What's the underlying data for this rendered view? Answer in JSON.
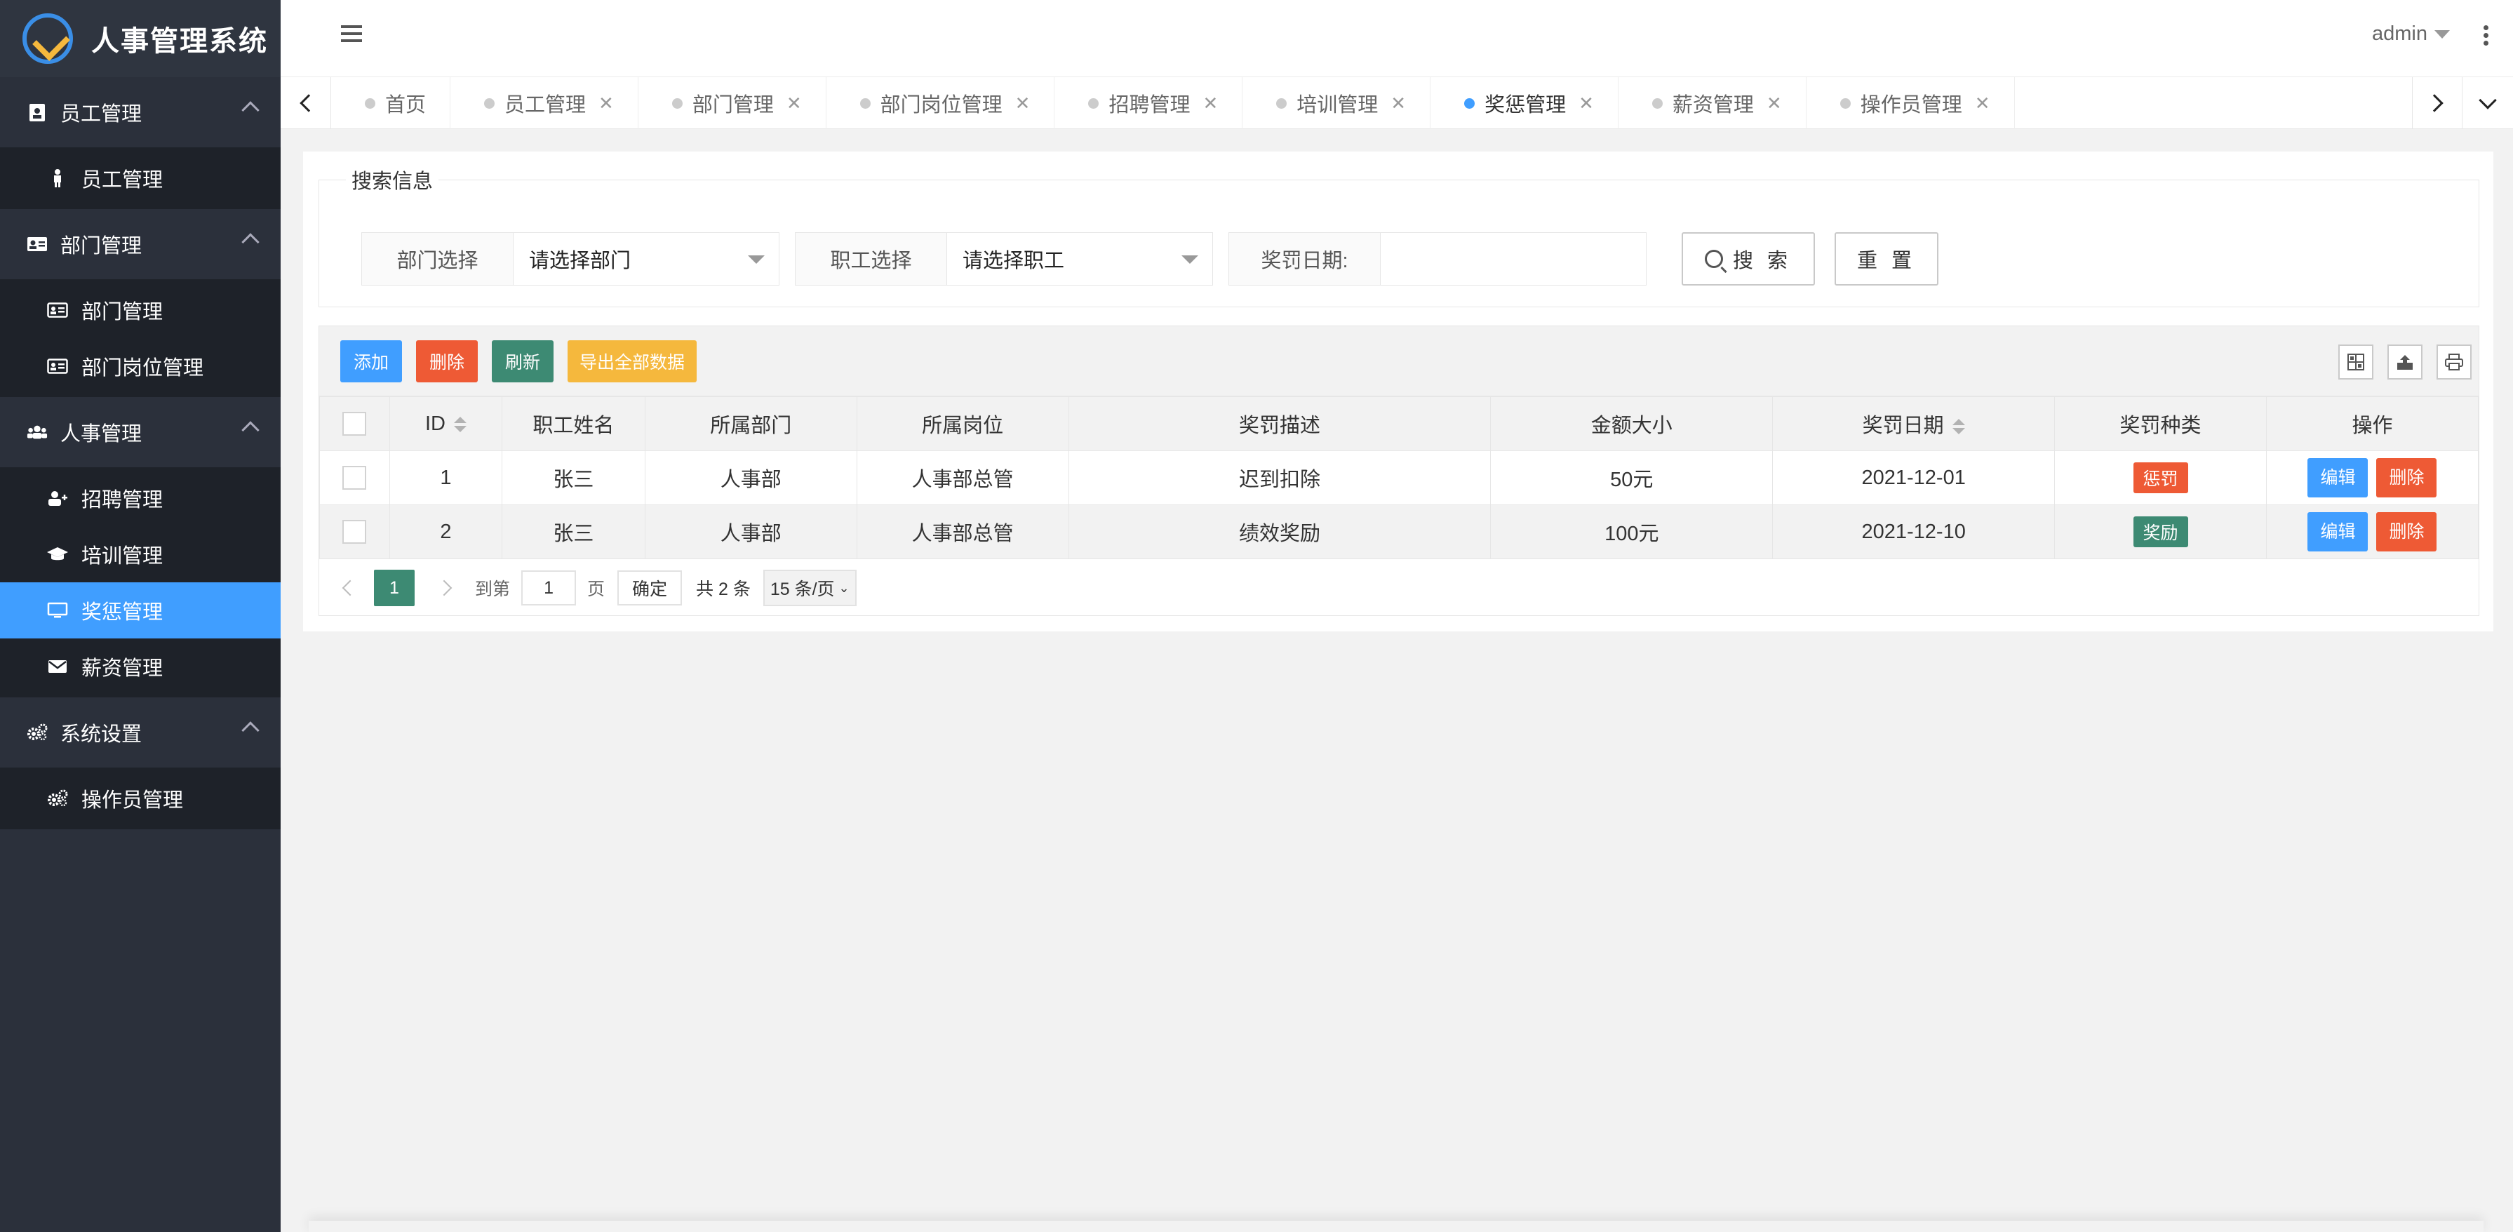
{
  "app": {
    "title": "人事管理系统"
  },
  "header": {
    "user": "admin"
  },
  "sidebar": {
    "groups": [
      {
        "label": "员工管理",
        "items": [
          {
            "label": "员工管理"
          }
        ]
      },
      {
        "label": "部门管理",
        "items": [
          {
            "label": "部门管理"
          },
          {
            "label": "部门岗位管理"
          }
        ]
      },
      {
        "label": "人事管理",
        "items": [
          {
            "label": "招聘管理"
          },
          {
            "label": "培训管理"
          },
          {
            "label": "奖惩管理",
            "active": true
          },
          {
            "label": "薪资管理"
          }
        ]
      },
      {
        "label": "系统设置",
        "items": [
          {
            "label": "操作员管理"
          }
        ]
      }
    ]
  },
  "tabs": [
    {
      "label": "首页"
    },
    {
      "label": "员工管理"
    },
    {
      "label": "部门管理"
    },
    {
      "label": "部门岗位管理"
    },
    {
      "label": "招聘管理"
    },
    {
      "label": "培训管理"
    },
    {
      "label": "奖惩管理",
      "active": true
    },
    {
      "label": "薪资管理"
    },
    {
      "label": "操作员管理"
    }
  ],
  "search": {
    "legend": "搜索信息",
    "dept_label": "部门选择",
    "dept_value": "请选择部门",
    "staff_label": "职工选择",
    "staff_value": "请选择职工",
    "date_label": "奖罚日期:",
    "date_value": "",
    "search_btn": "搜 索",
    "reset_btn": "重 置"
  },
  "toolbar": {
    "add": "添加",
    "delete": "删除",
    "refresh": "刷新",
    "export": "导出全部数据"
  },
  "table": {
    "columns": [
      "ID",
      "职工姓名",
      "所属部门",
      "所属岗位",
      "奖罚描述",
      "金额大小",
      "奖罚日期",
      "奖罚种类",
      "操作"
    ],
    "rows": [
      {
        "id": "1",
        "name": "张三",
        "dept": "人事部",
        "post": "人事部总管",
        "desc": "迟到扣除",
        "amount": "50元",
        "date": "2021-12-01",
        "type": "惩罚",
        "type_color": "#ee5a35",
        "edit": "编辑",
        "del": "删除"
      },
      {
        "id": "2",
        "name": "张三",
        "dept": "人事部",
        "post": "人事部总管",
        "desc": "绩效奖励",
        "amount": "100元",
        "date": "2021-12-10",
        "type": "奖励",
        "type_color": "#3d8a73",
        "edit": "编辑",
        "del": "删除"
      }
    ]
  },
  "pager": {
    "current": "1",
    "goto_label": "到第",
    "goto_value": "1",
    "page_unit": "页",
    "ok": "确定",
    "total": "共 2 条",
    "page_size": "15 条/页"
  },
  "colors": {
    "primary": "#409eff",
    "danger": "#ee5a35",
    "success": "#3d8a73",
    "warning": "#f5b83d",
    "sidebar": "#2b303b"
  }
}
